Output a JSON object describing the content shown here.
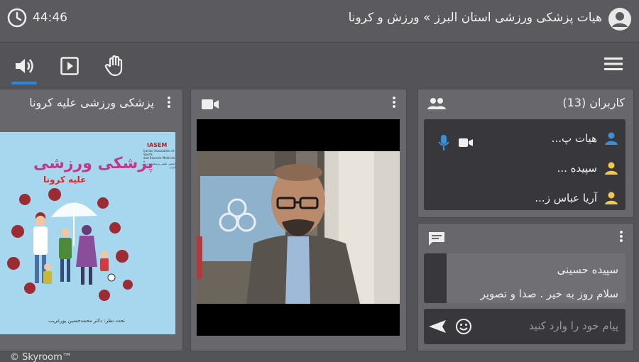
{
  "header": {
    "timer": "44:46",
    "room_title": "هیات پزشکی ورزشی استان البرز » ورزش و کرونا"
  },
  "toolbar": {
    "icons": [
      "speaker-icon",
      "play-icon",
      "raise-hand-icon",
      "menu-icon"
    ],
    "active": "speaker-icon"
  },
  "slide_panel": {
    "title": "پزشکی ورزشی علیه کرونا",
    "poster": {
      "headline": "پزشکی ورزشی",
      "subheadline": "علیه کرونا",
      "logo": "IASEM",
      "org_en_1": "Iranian Association of Sports",
      "org_en_2": "and Exercise Medicine",
      "org_fa": "انجمن علمی پزشکی ورزشی ایران",
      "credit": "تحت نظر: دکتر محمدحسین پورغریب"
    }
  },
  "video_panel": {
    "icon": "camera-icon"
  },
  "users_panel": {
    "title": "کاربران (13)",
    "users": [
      {
        "name": "هیات پ...",
        "color": "#3b8fd9",
        "mic": true,
        "cam": true
      },
      {
        "name": "سپیده ...",
        "color": "#f2c94c",
        "mic": false,
        "cam": false
      },
      {
        "name": "آریا عباس ز...",
        "color": "#f2c94c",
        "mic": false,
        "cam": false
      }
    ]
  },
  "chat_panel": {
    "sender": "سپیده حسینی",
    "message": "سلام روز به خیر . صدا و تصویر",
    "input_placeholder": "پیام خود را وارد کنید"
  },
  "footer": {
    "text": "© Skyroom™"
  },
  "colors": {
    "accent": "#2e86de",
    "background": "#545458",
    "panel": "#67676c",
    "inner_panel": "#38383c"
  }
}
